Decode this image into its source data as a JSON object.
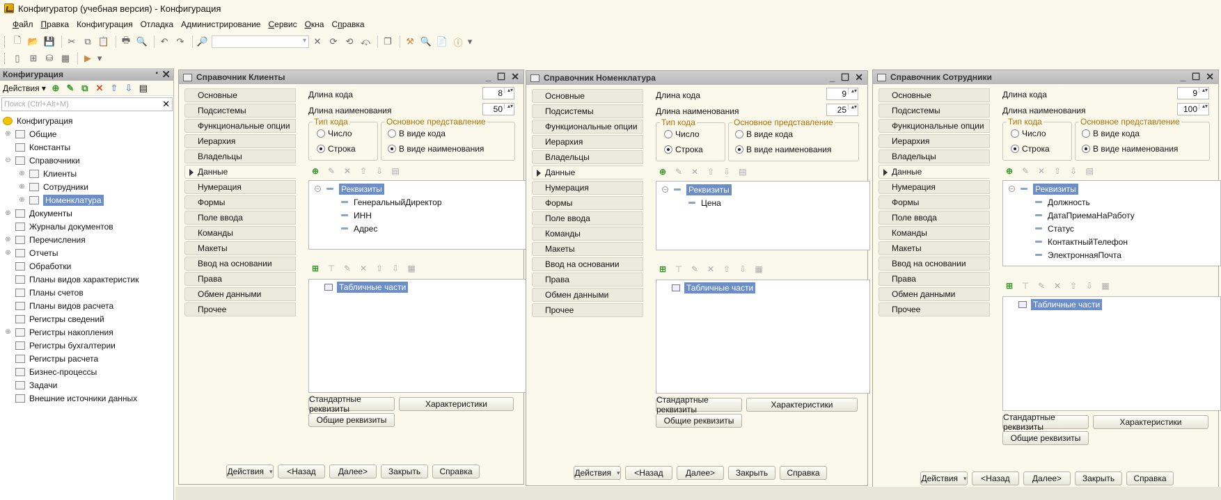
{
  "window_title": "Конфигуратор (учебная версия) - Конфигурация",
  "menu": [
    "Файл",
    "Правка",
    "Конфигурация",
    "Отладка",
    "Администрирование",
    "Сервис",
    "Окна",
    "Справка"
  ],
  "menu_access_keys": [
    "Ф",
    "П",
    "",
    "",
    "",
    "С",
    "О",
    "п"
  ],
  "left_panel": {
    "title": "Конфигурация",
    "actions_label": "Действия",
    "search_placeholder": "Поиск (Ctrl+Alt+M)",
    "tree": [
      {
        "label": "Конфигурация",
        "level": 0,
        "expander": "",
        "icon": "config-root-icon"
      },
      {
        "label": "Общие",
        "level": 1,
        "expander": "+",
        "icon": "common-icon"
      },
      {
        "label": "Константы",
        "level": 1,
        "expander": "",
        "icon": "constants-icon"
      },
      {
        "label": "Справочники",
        "level": 1,
        "expander": "−",
        "icon": "catalog-icon"
      },
      {
        "label": "Клиенты",
        "level": 2,
        "expander": "+",
        "icon": "catalog-icon"
      },
      {
        "label": "Сотрудники",
        "level": 2,
        "expander": "+",
        "icon": "catalog-icon"
      },
      {
        "label": "Номенклатура",
        "level": 2,
        "expander": "+",
        "icon": "catalog-icon",
        "selected": true
      },
      {
        "label": "Документы",
        "level": 1,
        "expander": "+",
        "icon": "document-icon"
      },
      {
        "label": "Журналы документов",
        "level": 1,
        "expander": "",
        "icon": "journal-icon"
      },
      {
        "label": "Перечисления",
        "level": 1,
        "expander": "+",
        "icon": "enum-icon"
      },
      {
        "label": "Отчеты",
        "level": 1,
        "expander": "+",
        "icon": "report-icon"
      },
      {
        "label": "Обработки",
        "level": 1,
        "expander": "",
        "icon": "processing-icon"
      },
      {
        "label": "Планы видов характеристик",
        "level": 1,
        "expander": "",
        "icon": "chart-types-icon"
      },
      {
        "label": "Планы счетов",
        "level": 1,
        "expander": "",
        "icon": "chart-accounts-icon"
      },
      {
        "label": "Планы видов расчета",
        "level": 1,
        "expander": "",
        "icon": "calc-types-icon"
      },
      {
        "label": "Регистры сведений",
        "level": 1,
        "expander": "",
        "icon": "info-register-icon"
      },
      {
        "label": "Регистры накопления",
        "level": 1,
        "expander": "+",
        "icon": "accum-register-icon"
      },
      {
        "label": "Регистры бухгалтерии",
        "level": 1,
        "expander": "",
        "icon": "account-register-icon"
      },
      {
        "label": "Регистры расчета",
        "level": 1,
        "expander": "",
        "icon": "calc-register-icon"
      },
      {
        "label": "Бизнес-процессы",
        "level": 1,
        "expander": "",
        "icon": "business-process-icon"
      },
      {
        "label": "Задачи",
        "level": 1,
        "expander": "",
        "icon": "tasks-icon"
      },
      {
        "label": "Внешние источники данных",
        "level": 1,
        "expander": "",
        "icon": "external-source-icon"
      }
    ]
  },
  "tab_labels": [
    "Основные",
    "Подсистемы",
    "Функциональные опции",
    "Иерархия",
    "Владельцы",
    "Данные",
    "Нумерация",
    "Формы",
    "Поле ввода",
    "Команды",
    "Макеты",
    "Ввод на основании",
    "Права",
    "Обмен данными",
    "Прочее"
  ],
  "common": {
    "code_length_label": "Длина кода",
    "name_length_label": "Длина наименования",
    "code_type_group": "Тип кода",
    "code_type_number": "Число",
    "code_type_string": "Строка",
    "main_repr_group": "Основное представление",
    "repr_as_code": "В виде кода",
    "repr_as_name": "В виде наименования",
    "attributes_root": "Реквизиты",
    "tabular_parts": "Табличные части",
    "btn_standard_attrs": "Стандартные реквизиты",
    "btn_characteristics": "Характеристики",
    "btn_common_attrs": "Общие реквизиты",
    "btn_actions": "Действия",
    "btn_back": "<Назад",
    "btn_next": "Далее>",
    "btn_close": "Закрыть",
    "btn_help": "Справка"
  },
  "windows": [
    {
      "title": "Справочник Клиенты",
      "code_length": "8",
      "name_length": "50",
      "attributes": [
        "ГенеральныйДиректор",
        "ИНН",
        "Адрес"
      ]
    },
    {
      "title": "Справочник Номенклатура",
      "code_length": "9",
      "name_length": "25",
      "attributes": [
        "Цена"
      ]
    },
    {
      "title": "Справочник Сотрудники",
      "code_length": "9",
      "name_length": "100",
      "attributes": [
        "Должность",
        "ДатаПриемаНаРаботу",
        "Статус",
        "КонтактныйТелефон",
        "ЭлектроннаяПочта"
      ]
    }
  ]
}
